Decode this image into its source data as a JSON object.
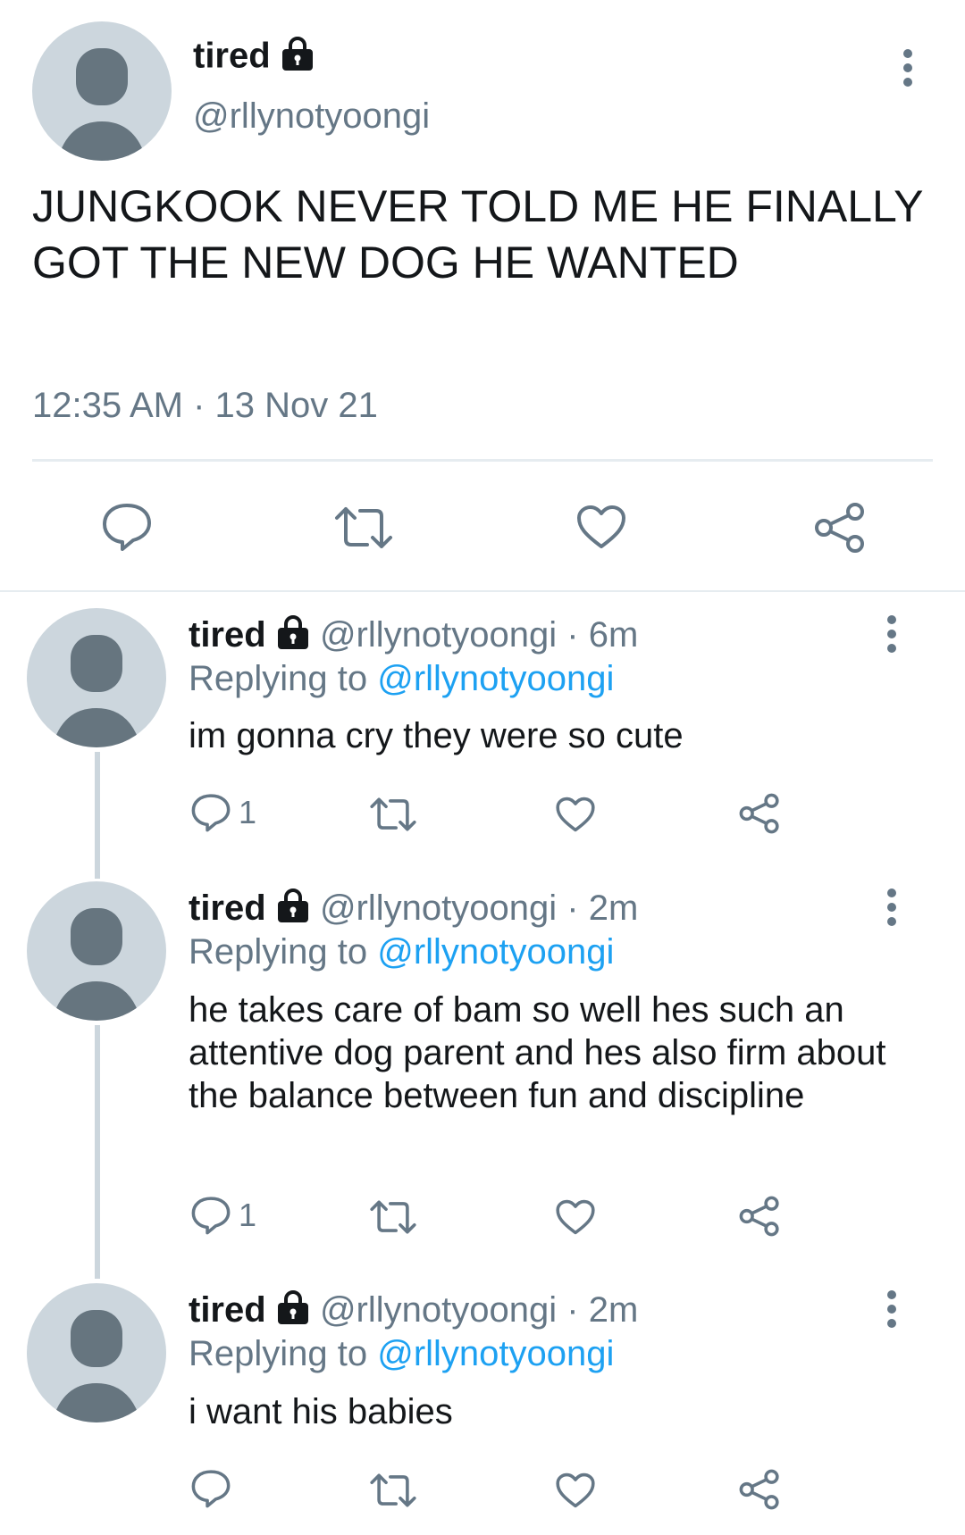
{
  "main_tweet": {
    "name": "tired",
    "handle": "@rllynotyoongi",
    "text": "JUNGKOOK NEVER TOLD ME HE FINALLY GOT THE NEW DOG HE WANTED",
    "timestamp": "12:35 AM · 13 Nov 21"
  },
  "replies": [
    {
      "name": "tired",
      "handle": "@rllynotyoongi",
      "separator": "·",
      "time": "6m",
      "replying_prefix": "Replying to ",
      "replying_to": "@rllynotyoongi",
      "text": "im gonna cry they were so cute",
      "reply_count": "1"
    },
    {
      "name": "tired",
      "handle": "@rllynotyoongi",
      "separator": "·",
      "time": "2m",
      "replying_prefix": "Replying to ",
      "replying_to": "@rllynotyoongi",
      "text": "he takes care of bam so well hes such an attentive dog parent and hes also firm about the balance between fun and discipline",
      "reply_count": "1"
    },
    {
      "name": "tired",
      "handle": "@rllynotyoongi",
      "separator": "·",
      "time": "2m",
      "replying_prefix": "Replying to ",
      "replying_to": "@rllynotyoongi",
      "text": "i want his babies",
      "reply_count": ""
    }
  ],
  "icons": {
    "lock": "lock-icon",
    "more": "more-vertical-icon",
    "reply": "comment-icon",
    "retweet": "retweet-icon",
    "like": "heart-icon",
    "share": "share-icon"
  },
  "colors": {
    "text": "#14171a",
    "secondary": "#657786",
    "link": "#1da1f2",
    "avatar_bg": "#ccd6dd",
    "avatar_fg": "#66757f"
  }
}
